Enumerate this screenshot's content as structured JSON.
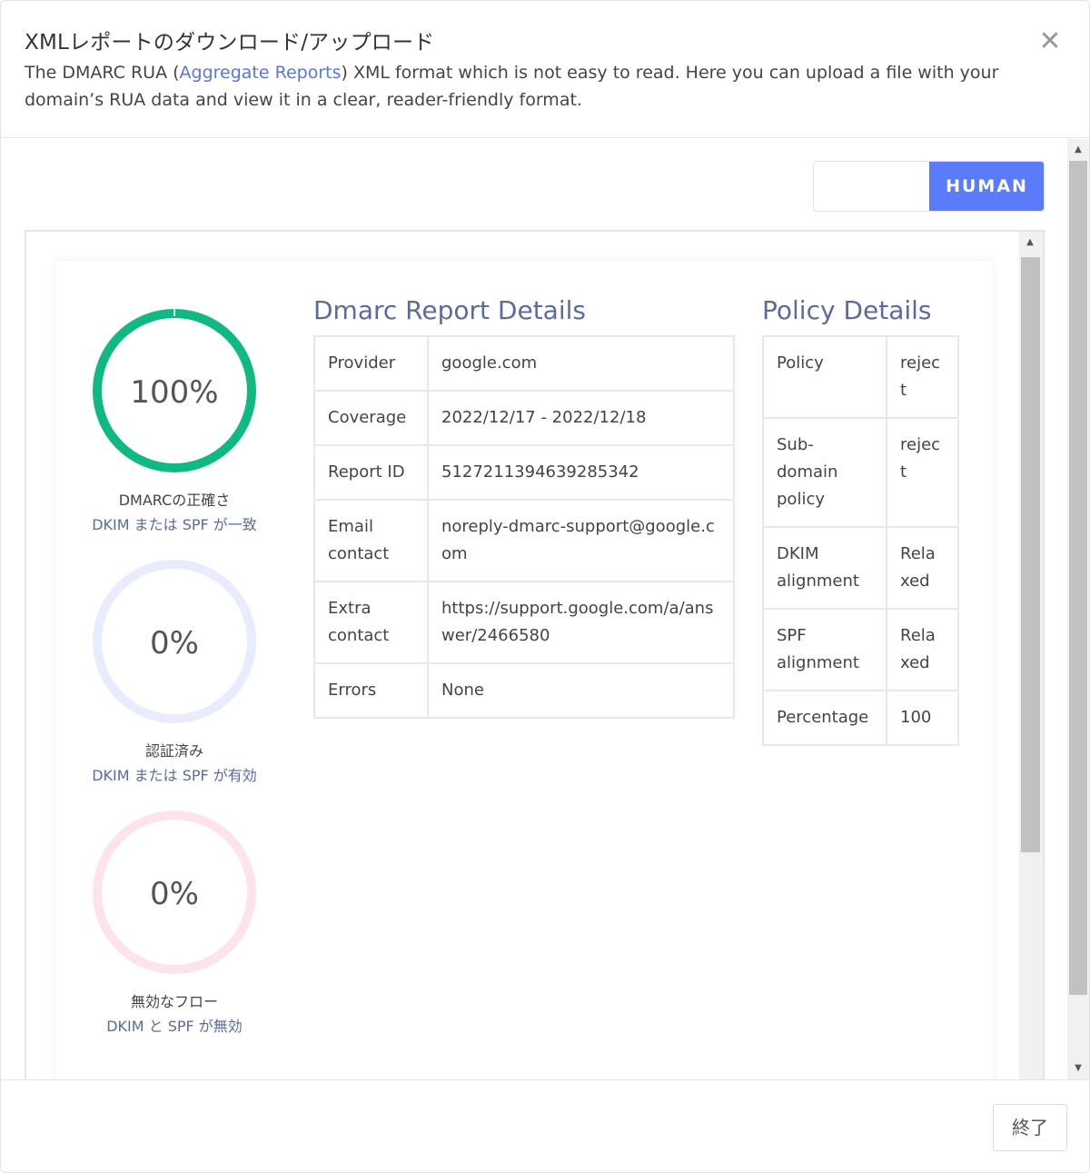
{
  "header": {
    "title": "XMLレポートのダウンロード/アップロード",
    "desc_prefix": "The DMARC RUA (",
    "desc_link": "Aggregate Reports",
    "desc_suffix": ") XML format which is not easy to read. Here you can upload a file with your domain’s RUA data and view it in a clear, reader-friendly format.",
    "close_icon": "close-icon"
  },
  "toggle": {
    "active_label": "HUMAN",
    "active_color": "#5b7cfa"
  },
  "gauges": [
    {
      "value_label": "100%",
      "value": 100,
      "label": "DMARCの正確さ",
      "sub": "DKIM または SPF が一致",
      "color": "#10b981",
      "track": "#10b981"
    },
    {
      "value_label": "0%",
      "value": 0,
      "label": "認証済み",
      "sub": "DKIM または SPF が有効",
      "color": "#5b7cfa",
      "track": "#e8ecfe"
    },
    {
      "value_label": "0%",
      "value": 0,
      "label": "無効なフロー",
      "sub": "DKIM と SPF が無効",
      "color": "#f43f5e",
      "track": "#fde4ea"
    }
  ],
  "report": {
    "title": "Dmarc Report Details",
    "rows": [
      {
        "key": "Provider",
        "value": "google.com"
      },
      {
        "key": "Coverage",
        "value": "2022/12/17 - 2022/12/18"
      },
      {
        "key": "Report ID",
        "value": "5127211394639285342"
      },
      {
        "key": "Email contact",
        "value": "noreply-dmarc-support@google.com"
      },
      {
        "key": "Extra contact",
        "value": "https://support.google.com/a/answer/2466580"
      },
      {
        "key": "Errors",
        "value": "None"
      }
    ]
  },
  "policy": {
    "title": "Policy Details",
    "rows": [
      {
        "key": "Policy",
        "value": "reject"
      },
      {
        "key": "Sub-domain policy",
        "value": "reject"
      },
      {
        "key": "DKIM alignment",
        "value": "Relaxed"
      },
      {
        "key": "SPF alignment",
        "value": "Relaxed"
      },
      {
        "key": "Percentage",
        "value": "100"
      }
    ]
  },
  "footer": {
    "close_label": "終了"
  }
}
